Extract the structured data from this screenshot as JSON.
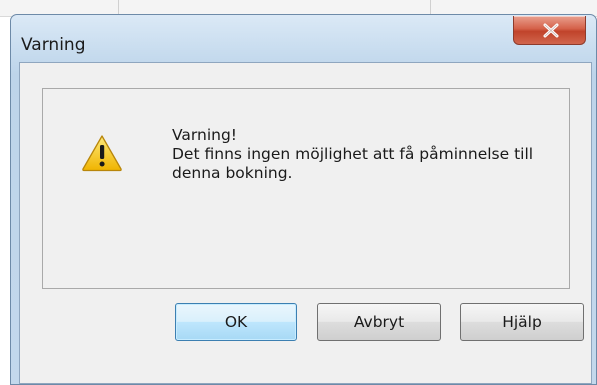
{
  "window": {
    "title": "Varning",
    "close_icon": "close-icon"
  },
  "message": {
    "icon": "warning-icon",
    "heading": "Varning!",
    "line1": "Det finns ingen möjlighet att få påminnelse till",
    "line2": "denna bokning."
  },
  "buttons": {
    "ok": "OK",
    "cancel": "Avbryt",
    "help": "Hjälp"
  },
  "colors": {
    "close_button": "#c7462d",
    "default_button_border": "#3c7fb1",
    "warning_yellow": "#f7c600"
  }
}
